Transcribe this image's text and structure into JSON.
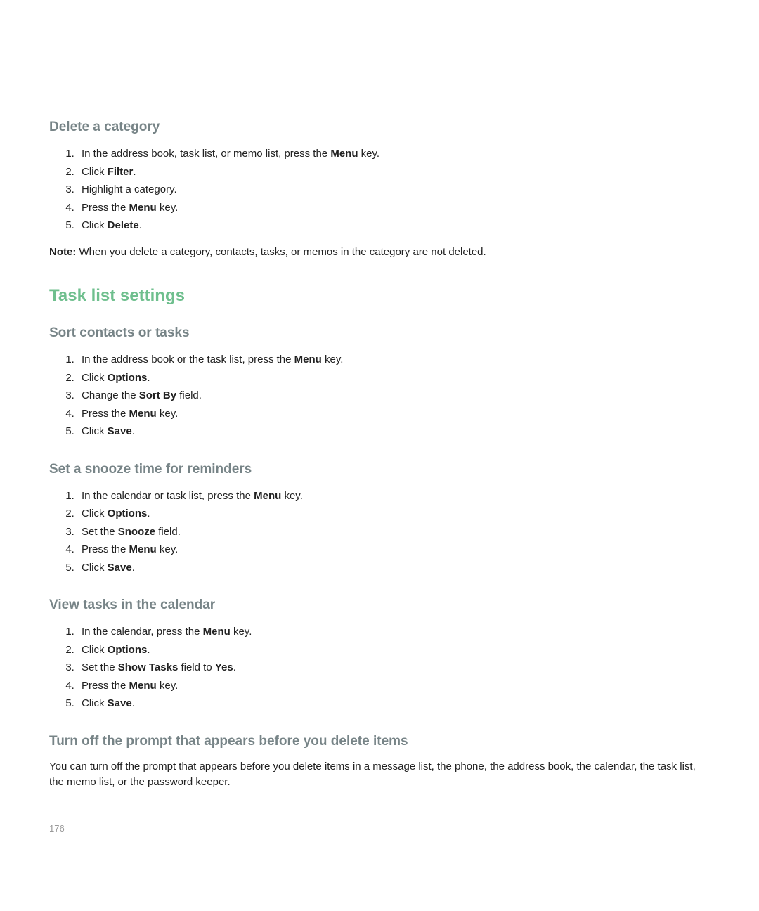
{
  "sections": [
    {
      "heading_level": "h2",
      "heading": "Delete a category",
      "steps": [
        [
          {
            "t": "In the address book, task list, or memo list, press the "
          },
          {
            "t": "Menu",
            "b": true
          },
          {
            "t": " key."
          }
        ],
        [
          {
            "t": "Click "
          },
          {
            "t": "Filter",
            "b": true
          },
          {
            "t": "."
          }
        ],
        [
          {
            "t": "Highlight a category."
          }
        ],
        [
          {
            "t": "Press the "
          },
          {
            "t": "Menu",
            "b": true
          },
          {
            "t": " key."
          }
        ],
        [
          {
            "t": "Click "
          },
          {
            "t": "Delete",
            "b": true
          },
          {
            "t": "."
          }
        ]
      ],
      "footer": [
        {
          "t": "Note:",
          "b": true
        },
        {
          "t": "  When you delete a category, contacts, tasks, or memos in the category are not deleted."
        }
      ]
    },
    {
      "heading_level": "h1",
      "heading": "Task list settings"
    },
    {
      "heading_level": "h2",
      "heading": "Sort contacts or tasks",
      "steps": [
        [
          {
            "t": "In the address book or the task list, press the "
          },
          {
            "t": "Menu",
            "b": true
          },
          {
            "t": " key."
          }
        ],
        [
          {
            "t": "Click "
          },
          {
            "t": "Options",
            "b": true
          },
          {
            "t": "."
          }
        ],
        [
          {
            "t": "Change the "
          },
          {
            "t": "Sort By",
            "b": true
          },
          {
            "t": " field."
          }
        ],
        [
          {
            "t": "Press the "
          },
          {
            "t": "Menu",
            "b": true
          },
          {
            "t": " key."
          }
        ],
        [
          {
            "t": "Click "
          },
          {
            "t": "Save",
            "b": true
          },
          {
            "t": "."
          }
        ]
      ]
    },
    {
      "heading_level": "h2",
      "heading": "Set a snooze time for reminders",
      "steps": [
        [
          {
            "t": "In the calendar or task list, press the "
          },
          {
            "t": "Menu",
            "b": true
          },
          {
            "t": " key."
          }
        ],
        [
          {
            "t": "Click "
          },
          {
            "t": "Options",
            "b": true
          },
          {
            "t": "."
          }
        ],
        [
          {
            "t": "Set the "
          },
          {
            "t": "Snooze",
            "b": true
          },
          {
            "t": " field."
          }
        ],
        [
          {
            "t": "Press the "
          },
          {
            "t": "Menu",
            "b": true
          },
          {
            "t": " key."
          }
        ],
        [
          {
            "t": "Click "
          },
          {
            "t": "Save",
            "b": true
          },
          {
            "t": "."
          }
        ]
      ]
    },
    {
      "heading_level": "h2",
      "heading": "View tasks in the calendar",
      "steps": [
        [
          {
            "t": "In the calendar, press the "
          },
          {
            "t": "Menu",
            "b": true
          },
          {
            "t": " key."
          }
        ],
        [
          {
            "t": "Click "
          },
          {
            "t": "Options",
            "b": true
          },
          {
            "t": "."
          }
        ],
        [
          {
            "t": "Set the "
          },
          {
            "t": "Show Tasks",
            "b": true
          },
          {
            "t": " field to "
          },
          {
            "t": "Yes",
            "b": true
          },
          {
            "t": "."
          }
        ],
        [
          {
            "t": "Press the "
          },
          {
            "t": "Menu",
            "b": true
          },
          {
            "t": " key."
          }
        ],
        [
          {
            "t": "Click "
          },
          {
            "t": "Save",
            "b": true
          },
          {
            "t": "."
          }
        ]
      ]
    },
    {
      "heading_level": "h2",
      "heading": "Turn off the prompt that appears before you delete items",
      "body": [
        {
          "t": "You can turn off the prompt that appears before you delete items in a message list, the phone, the address book, the calendar, the task list, the memo list, or the password keeper."
        }
      ]
    }
  ],
  "page_number": "176"
}
